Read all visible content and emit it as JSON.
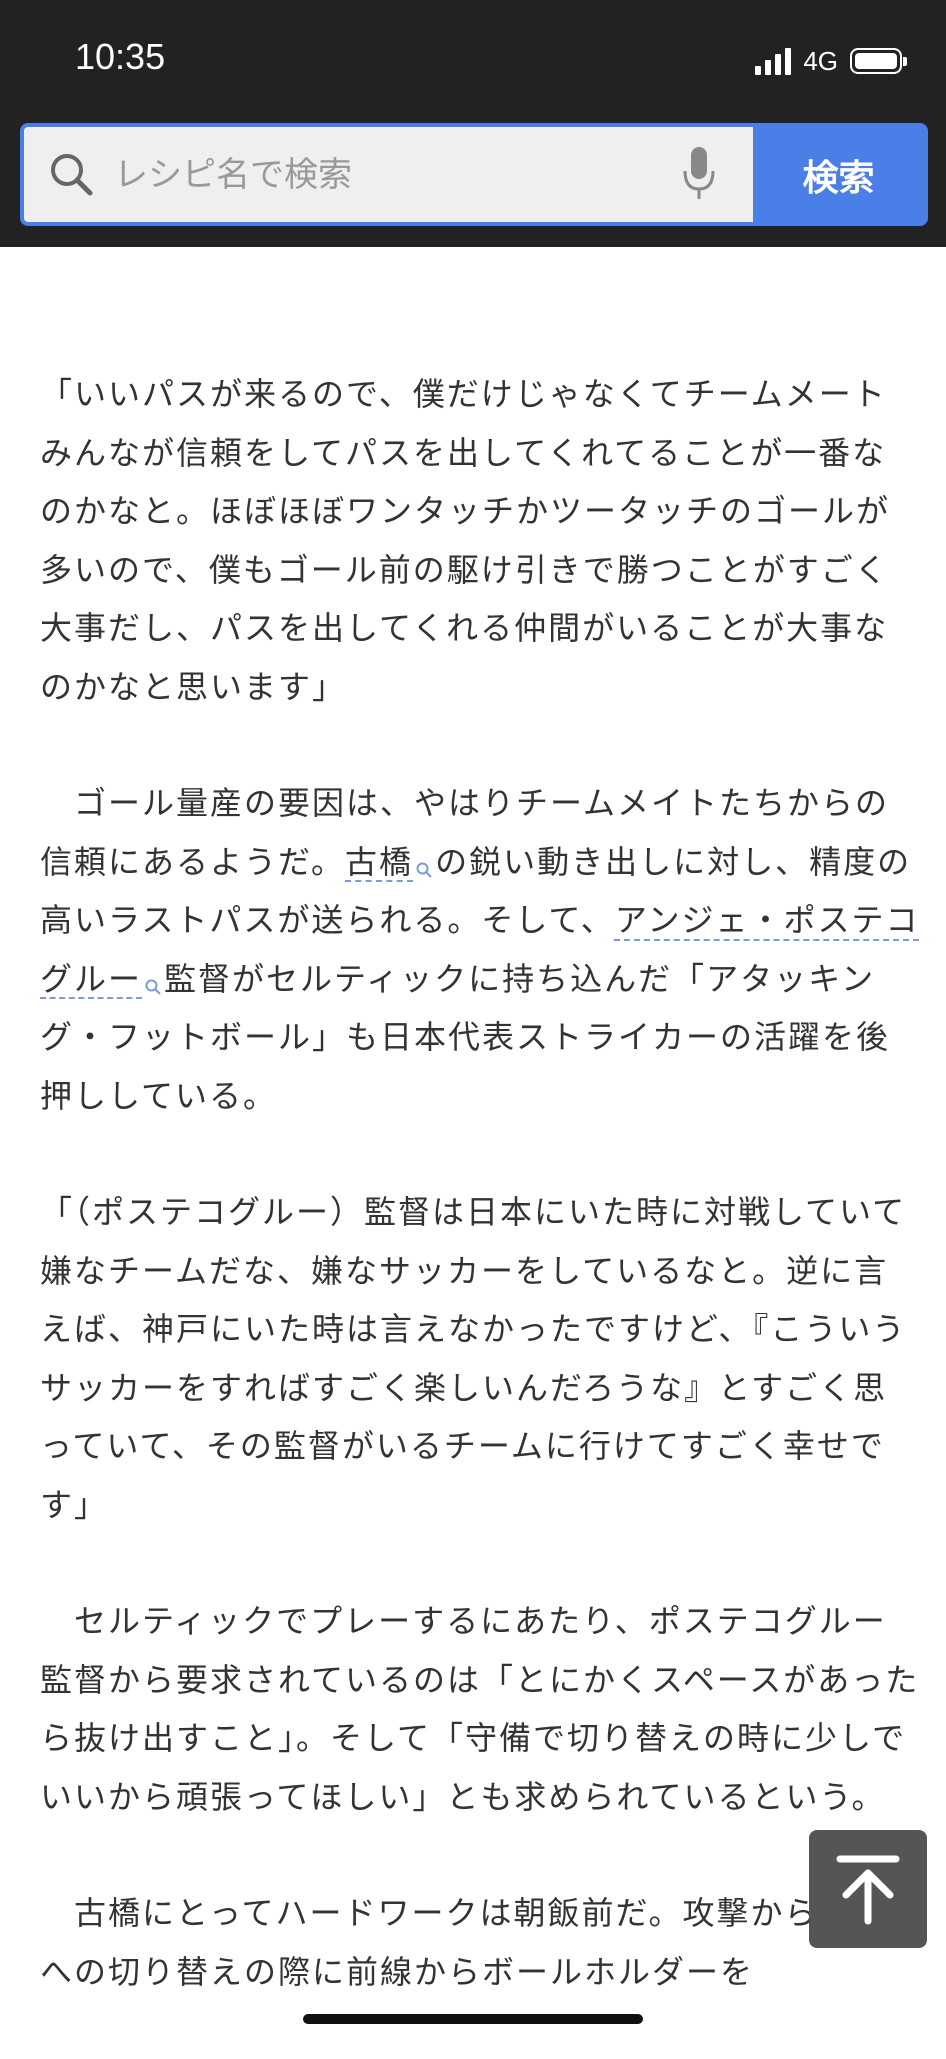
{
  "status_bar": {
    "time": "10:35",
    "network": "4G"
  },
  "search": {
    "placeholder": "レシピ名で検索",
    "button_label": "検索",
    "accent_color": "#4a7fe8"
  },
  "icons": {
    "search": "search-icon",
    "microphone": "microphone-icon",
    "link_search": "magnifier-link-icon",
    "scroll_top": "arrow-up-icon"
  },
  "article": {
    "p1": "「いいパスが来るので、僕だけじゃなくてチームメートみんなが信頼をしてパスを出してくれてることが一番なのかなと。ほぼほぼワンタッチかツータッチのゴールが多いので、僕もゴール前の駆け引きで勝つことがすごく大事だし、パスを出してくれる仲間がいることが大事なのかなと思います」",
    "p2_a": "　ゴール量産の要因は、やはりチームメイトたちからの信頼にあるようだ。",
    "p2_link1": "古橋",
    "p2_b": "の鋭い動き出しに対し、精度の高いラストパスが送られる。そして、",
    "p2_link2": "アンジェ・ポステコグルー",
    "p2_c": "監督がセルティックに持ち込んだ「アタッキング・フットボール」も日本代表ストライカーの活躍を後押ししている。",
    "p3": "「（ポステコグルー）監督は日本にいた時に対戦していて嫌なチームだな、嫌なサッカーをしているなと。逆に言えば、神戸にいた時は言えなかったですけど、『こういうサッカーをすればすごく楽しいんだろうな』とすごく思っていて、その監督がいるチームに行けてすごく幸せです」",
    "p4": "　セルティックでプレーするにあたり、ポステコグルー監督から要求されているのは「とにかくスペースがあったら抜け出すこと」。そして「守備で切り替えの時に少しでいいから頑張ってほしい」とも求められているという。",
    "p5": "　古橋にとってハードワークは朝飯前だ。攻撃から守備への切り替えの際に前線からボールホルダーを"
  }
}
